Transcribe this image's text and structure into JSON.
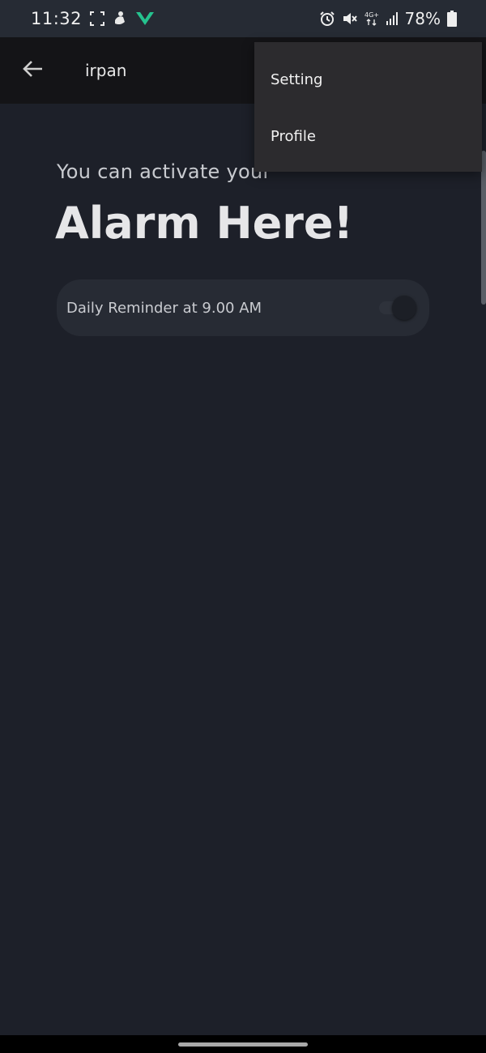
{
  "status_bar": {
    "time": "11:32",
    "battery_percent": "78%",
    "network_label": "4G+",
    "icons_left": [
      "screenshot-frame-icon",
      "hand-notification-icon",
      "vpn-chevron-icon"
    ],
    "icons_right": [
      "alarm-icon",
      "mute-icon",
      "network-4g-icon",
      "signal-icon",
      "battery-icon"
    ],
    "accent_icon_color": "#25c28e"
  },
  "app_bar": {
    "back_icon": "arrow-left-icon",
    "title": "irpan"
  },
  "menu": {
    "items": [
      {
        "label": "Setting"
      },
      {
        "label": "Profile"
      }
    ]
  },
  "main": {
    "subtitle": "You can activate your",
    "headline": "Alarm Here!",
    "reminder": {
      "label": "Daily Reminder at 9.00 AM",
      "enabled": false
    }
  },
  "colors": {
    "background": "#1d2029",
    "app_bar": "#141417",
    "menu": "#2c2b2e",
    "card": "#272b34"
  }
}
